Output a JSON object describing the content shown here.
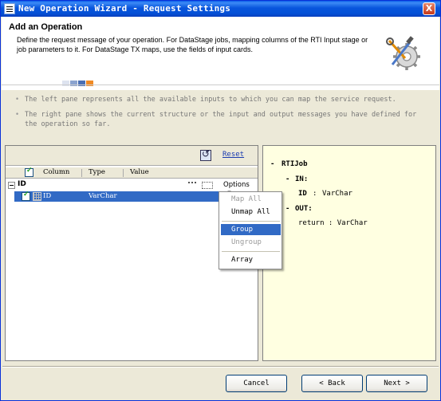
{
  "window": {
    "title": "New Operation Wizard - Request Settings",
    "close_label": "X"
  },
  "header": {
    "title": "Add an Operation",
    "description": "Define the request message of your operation. For DataStage jobs, mapping columns of the RTI Input stage or job parameters to it. For DataStage TX maps, use the fields of input cards."
  },
  "info": {
    "line1": "The left pane represents all the available inputs to which you can map the service request.",
    "line2": "The right pane shows the current structure or the input and output messages you have defined for the operation so far."
  },
  "left_pane": {
    "reset_label": "Reset",
    "columns": [
      "Column",
      "Type",
      "Value"
    ],
    "group": {
      "label": "ID",
      "options_label": "Options"
    },
    "rows": [
      {
        "column": "ID",
        "type": "VarChar",
        "value": "",
        "checked": true,
        "selected": true
      }
    ]
  },
  "context_menu": {
    "items": [
      {
        "label": "Map All",
        "enabled": false
      },
      {
        "label": "Unmap All",
        "enabled": true
      },
      {
        "label": "Group",
        "enabled": true,
        "highlighted": true
      },
      {
        "label": "Ungroup",
        "enabled": false
      },
      {
        "label": "Array",
        "enabled": true
      }
    ]
  },
  "right_pane": {
    "root": "RTIJob",
    "in_label": "IN:",
    "in_field_name": "ID",
    "in_field_sep": ":",
    "in_field_type": "VarChar",
    "out_label": "OUT:",
    "out_field": "return : VarChar",
    "collapse_mark": "-"
  },
  "buttons": {
    "cancel": "Cancel",
    "back": "< Back",
    "next": "Next >"
  },
  "colors": {
    "titlebar": "#0a5ee8",
    "selection": "#316ac5",
    "right_pane_bg": "#ffffe1",
    "link": "#1a3bb0"
  },
  "icons": {
    "header_art": "gear-tools-icon",
    "reset": "refresh-icon",
    "expander": "collapse-icon",
    "options": "dropdown-arrow-icon"
  }
}
